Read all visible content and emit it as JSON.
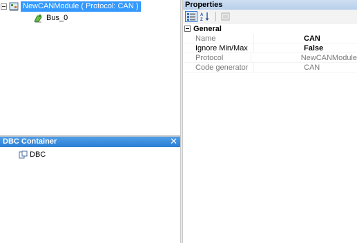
{
  "tree": {
    "root_label": "NewCANModule ( Protocol: CAN )",
    "child_label": "Bus_0"
  },
  "dbc_container": {
    "title": "DBC Container",
    "close_glyph": "✕",
    "item_label": "DBC"
  },
  "properties": {
    "title": "Properties",
    "category": "General",
    "rows": [
      {
        "name": "Name",
        "value": "CAN"
      },
      {
        "name": "Ignore Min/Max",
        "value": "False"
      },
      {
        "name": "Protocol",
        "value": "NewCANModule"
      },
      {
        "name": "Code generator",
        "value": "CAN"
      }
    ]
  },
  "icons": {
    "root": "can-module-icon",
    "bus": "bus-icon",
    "dbc": "document-icon",
    "toolbar": [
      "categorized-icon",
      "alphabetical-sort-icon",
      "property-pages-icon"
    ]
  },
  "colors": {
    "selection": "#3399ff",
    "panel_header": "#2c7fd4",
    "properties_header": "#b8cfea"
  }
}
